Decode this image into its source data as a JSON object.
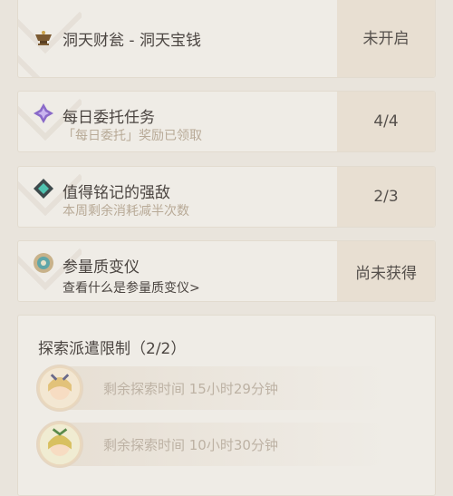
{
  "rows": [
    {
      "title": "洞天财瓮 - 洞天宝钱",
      "subtitle": "",
      "link": "",
      "value": "未开启",
      "icon": "teapot-icon"
    },
    {
      "title": "每日委托任务",
      "subtitle": "「每日委托」奖励已领取",
      "link": "",
      "value": "4/4",
      "icon": "commission-star-icon"
    },
    {
      "title": "值得铭记的强敌",
      "subtitle": "本周剩余消耗减半次数",
      "link": "",
      "value": "2/3",
      "icon": "weekly-boss-icon"
    },
    {
      "title": "参量质变仪",
      "subtitle": "",
      "link": "查看什么是参量质变仪>",
      "value": "尚未获得",
      "icon": "transformer-icon"
    }
  ],
  "expedition": {
    "title": "探索派遣限制（2/2）",
    "items": [
      {
        "text": "剩余探索时间 15小时29分钟",
        "icon": "character-avatar"
      },
      {
        "text": "剩余探索时间 10小时30分钟",
        "icon": "character-avatar"
      }
    ]
  }
}
